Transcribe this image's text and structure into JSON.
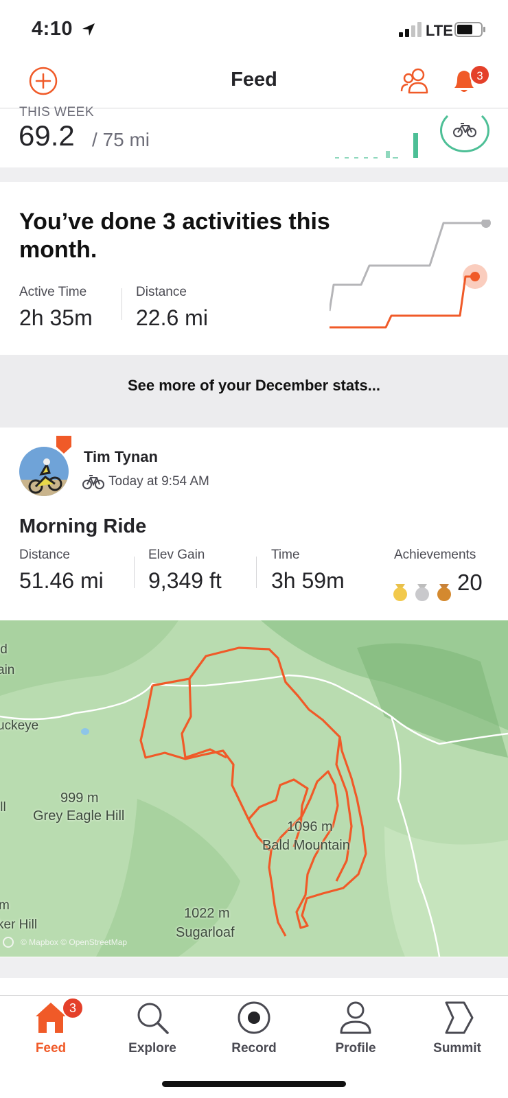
{
  "status_bar": {
    "time": "4:10",
    "network": "LTE"
  },
  "header": {
    "title": "Feed",
    "notification_count": "3"
  },
  "this_week": {
    "label": "THIS WEEK",
    "value": "69.2",
    "goal": "/ 75 mi",
    "goal_progress_fraction": 0.923,
    "accent_color": "#4dbf96"
  },
  "month_summary": {
    "headline": "You’ve done 3 activities this month.",
    "stats": [
      {
        "label": "Active Time",
        "value": "2h 35m"
      },
      {
        "label": "Distance",
        "value": "22.6 mi"
      }
    ],
    "link": "See more of your December stats...",
    "current_color": "#f05a28",
    "previous_color": "#b5b5b8"
  },
  "activity": {
    "athlete": "Tim Tynan",
    "timestamp": "Today at 9:54 AM",
    "title": "Morning Ride",
    "stats": [
      {
        "label": "Distance",
        "value": "51.46 mi"
      },
      {
        "label": "Elev Gain",
        "value": "9,349 ft"
      },
      {
        "label": "Time",
        "value": "3h 59m"
      },
      {
        "label": "Achievements",
        "value": "20"
      }
    ],
    "achievement_icons": [
      "gold-medal-icon",
      "silver-medal-icon",
      "bronze-medal-icon"
    ]
  },
  "map": {
    "labels": [
      "ld",
      "ain",
      "uckeye",
      "999 m",
      "Grey Eagle Hill",
      "ill",
      "1096 m",
      "Bald Mountain",
      "m",
      "ker Hill",
      "1022 m",
      "Sugarloaf"
    ],
    "attribution": "© Mapbox © OpenStreetMap",
    "route_color": "#f05a28"
  },
  "tabs": [
    {
      "label": "Feed",
      "icon": "home-icon",
      "active": true,
      "badge": "3"
    },
    {
      "label": "Explore",
      "icon": "search-icon",
      "active": false
    },
    {
      "label": "Record",
      "icon": "record-icon",
      "active": false
    },
    {
      "label": "Profile",
      "icon": "profile-icon",
      "active": false
    },
    {
      "label": "Summit",
      "icon": "summit-icon",
      "active": false
    }
  ]
}
